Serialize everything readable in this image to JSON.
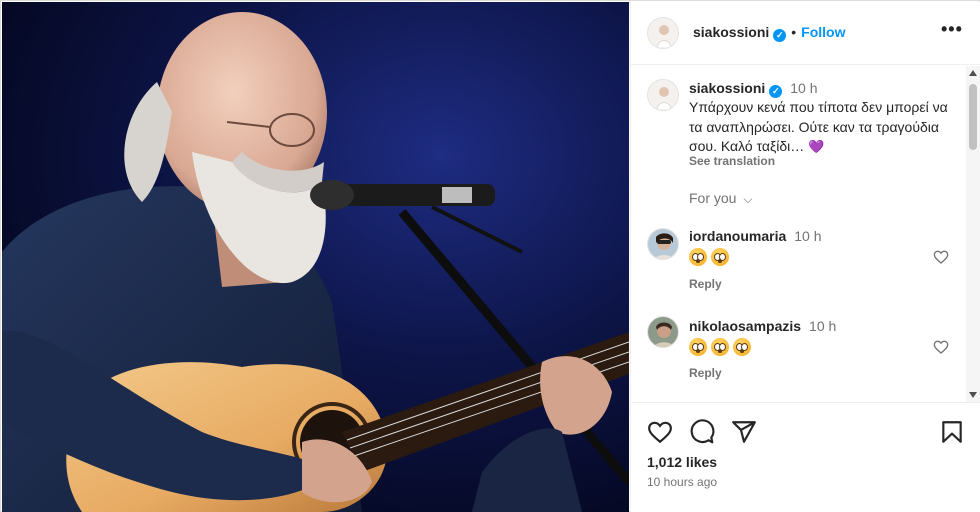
{
  "post": {
    "username": "siakossioni",
    "follow_label": "Follow",
    "dot": "•",
    "more_label": "•••",
    "caption_time": "10 h",
    "caption_text": "Υπάρχουν κενά που τίποτα δεν μπορεί να τα αναπληρώσει. Ούτε καν τα τραγούδια σου. Καλό ταξίδι…",
    "caption_emoji": "💜",
    "see_translation": "See translation",
    "for_you_label": "For you",
    "for_you_chevron": "⌵",
    "likes": "1,012 likes",
    "posted_time": "10 hours ago"
  },
  "comments": [
    {
      "username": "iordanoumaria",
      "time": "10 h",
      "emoji_count": 2,
      "reply_label": "Reply"
    },
    {
      "username": "nikolaosampazis",
      "time": "10 h",
      "emoji_count": 3,
      "reply_label": "Reply"
    }
  ],
  "icons": {
    "like": "heart-icon",
    "comment": "comment-icon",
    "share": "send-icon",
    "save": "bookmark-icon",
    "verified": "verified-badge-icon",
    "emoji": "flushed-face-emoji"
  },
  "colors": {
    "accent": "#0095f6",
    "text": "#262626",
    "muted": "#737373",
    "border": "#efefef"
  }
}
